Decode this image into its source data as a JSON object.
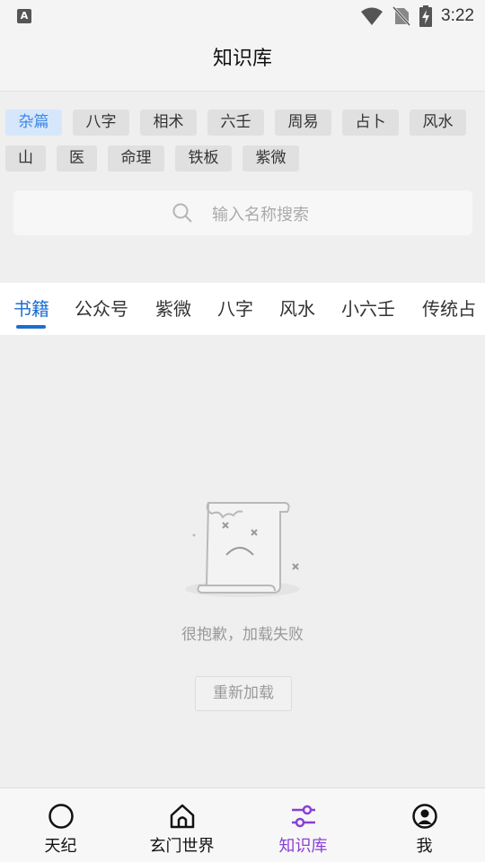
{
  "status_bar": {
    "app_badge": "A",
    "time": "3:22"
  },
  "header": {
    "title": "知识库"
  },
  "categories": [
    "杂篇",
    "八字",
    "相术",
    "六壬",
    "周易",
    "占卜",
    "风水",
    "山",
    "医",
    "命理",
    "铁板",
    "紫微"
  ],
  "search": {
    "placeholder": "输入名称搜索"
  },
  "tabs": [
    "书籍",
    "公众号",
    "紫微",
    "八字",
    "风水",
    "小六壬",
    "传统占"
  ],
  "empty_state": {
    "message": "很抱歉，加载失败",
    "reload_label": "重新加载"
  },
  "bottom_nav": [
    {
      "label": "天纪",
      "icon": "circle-icon"
    },
    {
      "label": "玄门世界",
      "icon": "home-icon"
    },
    {
      "label": "知识库",
      "icon": "sliders-icon"
    },
    {
      "label": "我",
      "icon": "user-icon"
    }
  ],
  "colors": {
    "accent_blue": "#1c6dd1",
    "nav_active_purple": "#8a3fd6",
    "chip_active_bg": "#d7e7fb"
  }
}
